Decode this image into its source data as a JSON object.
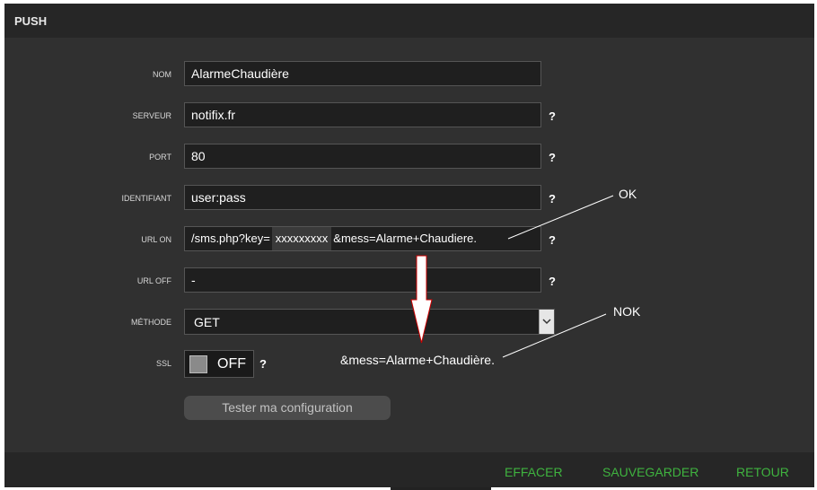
{
  "header": {
    "title": "PUSH"
  },
  "form": {
    "nom": {
      "label": "NOM",
      "value": "AlarmeChaudière"
    },
    "serveur": {
      "label": "SERVEUR",
      "value": "notifix.fr",
      "help": "?"
    },
    "port": {
      "label": "PORT",
      "value": "80",
      "help": "?"
    },
    "identifiant": {
      "label": "IDENTIFIANT",
      "value": "user:pass",
      "help": "?"
    },
    "url_on": {
      "label": "URL ON",
      "value_prefix": "/sms.php?key=",
      "value_key": "xxxxxxxxx",
      "value_suffix": "&mess=Alarme+Chaudiere.",
      "help": "?"
    },
    "url_off": {
      "label": "URL OFF",
      "value": "-",
      "help": "?"
    },
    "methode": {
      "label": "MÉTHODE",
      "value": "GET"
    },
    "ssl": {
      "label": "SSL",
      "value": "OFF",
      "help": "?"
    },
    "test_button": "Tester ma configuration"
  },
  "annotations": {
    "ok_label": "OK",
    "nok_label": "NOK",
    "nok_example": "&mess=Alarme+Chaudière.",
    "arrow_color": "#cc0000"
  },
  "footer": {
    "effacer": "EFFACER",
    "sauvegarder": "SAUVEGARDER",
    "retour": "RETOUR"
  },
  "colors": {
    "accent": "#3fb33f",
    "panel": "#303030",
    "bar": "#262626"
  }
}
